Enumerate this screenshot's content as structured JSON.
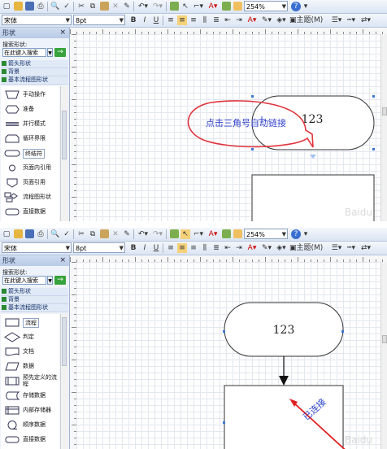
{
  "toolbar": {
    "zoom": "254%",
    "font_name": "宋体",
    "font_size": "8pt",
    "theme_label": "主题(M)",
    "bold": "B",
    "italic": "I",
    "underline": "U",
    "font_color_label": "A",
    "help_glyph": "?"
  },
  "sidebar": {
    "title": "形状",
    "close": "×",
    "search_label": "搜索形状:",
    "search_placeholder": "在此键入搜索",
    "search_go": "→",
    "stencils": [
      "箭头形状",
      "背景",
      "基本流程图形状"
    ]
  },
  "panel_top": {
    "shapes": [
      {
        "label": "手动操作",
        "icon": "manual-operation-icon"
      },
      {
        "label": "准备",
        "icon": "preparation-icon"
      },
      {
        "label": "并行模式",
        "icon": "parallel-mode-icon"
      },
      {
        "label": "循环界限",
        "icon": "loop-limit-icon"
      },
      {
        "label": "终结符",
        "icon": "terminator-icon",
        "selected": true
      },
      {
        "label": "页面内引用",
        "icon": "on-page-reference-icon"
      },
      {
        "label": "页面引用",
        "icon": "off-page-reference-icon"
      },
      {
        "label": "流程图形状",
        "icon": "flowchart-shapes-icon"
      },
      {
        "label": "直接数据",
        "icon": "direct-data-icon"
      }
    ],
    "canvas": {
      "terminator_text": "123",
      "callout_text": "点击三角号自动链接"
    }
  },
  "panel_bottom": {
    "shapes": [
      {
        "label": "流程",
        "icon": "process-icon",
        "selected": true
      },
      {
        "label": "判定",
        "icon": "decision-icon"
      },
      {
        "label": "文档",
        "icon": "document-icon"
      },
      {
        "label": "数据",
        "icon": "data-icon"
      },
      {
        "label": "预先定义的流程",
        "icon": "predefined-process-icon"
      },
      {
        "label": "存储数据",
        "icon": "stored-data-icon"
      },
      {
        "label": "内部存储器",
        "icon": "internal-storage-icon"
      },
      {
        "label": "顺序数据",
        "icon": "sequential-data-icon"
      },
      {
        "label": "直接数据",
        "icon": "direct-data-icon"
      }
    ],
    "canvas": {
      "terminator_text": "123",
      "annotation_text": "已连接"
    }
  },
  "colors": {
    "callout_outline": "#e0343d",
    "callout_text": "#3344cc",
    "annotation_text": "#2b44c8",
    "annotation_arrow": "#e02020",
    "connector": "#111111",
    "shape_outline": "#333333",
    "grid": "#e3e7ee"
  }
}
